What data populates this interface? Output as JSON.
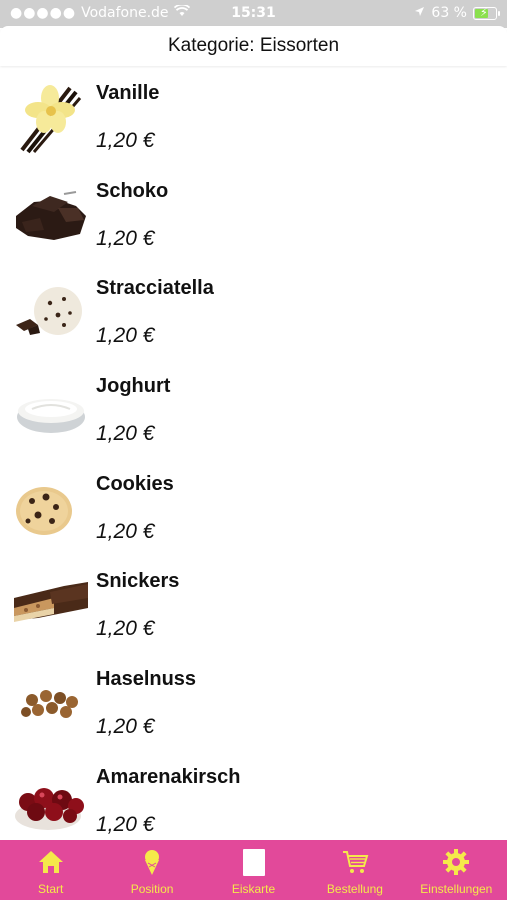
{
  "status_bar": {
    "carrier": "Vodafone.de",
    "time": "15:31",
    "battery": "63 %"
  },
  "header": {
    "title": "Kategorie: Eissorten"
  },
  "items": [
    {
      "name": "Vanille",
      "price": "1,20 €",
      "image": "vanilla-flower-icon"
    },
    {
      "name": "Schoko",
      "price": "1,20 €",
      "image": "chocolate-icon"
    },
    {
      "name": "Stracciatella",
      "price": "1,20 €",
      "image": "stracciatella-scoop-icon"
    },
    {
      "name": "Joghurt",
      "price": "1,20 €",
      "image": "yogurt-bowl-icon"
    },
    {
      "name": "Cookies",
      "price": "1,20 €",
      "image": "cookie-icon"
    },
    {
      "name": "Snickers",
      "price": "1,20 €",
      "image": "snickers-bar-icon"
    },
    {
      "name": "Haselnuss",
      "price": "1,20 €",
      "image": "hazelnut-icon"
    },
    {
      "name": "Amarenakirsch",
      "price": "1,20 €",
      "image": "cherry-bowl-icon"
    }
  ],
  "tabbar": {
    "accent_color": "#f5e94a",
    "background_color": "#e2499a",
    "tabs": [
      {
        "label": "Start",
        "icon": "home-icon"
      },
      {
        "label": "Position",
        "icon": "ice-cream-cone-icon"
      },
      {
        "label": "Eiskarte",
        "icon": "menu-card-icon"
      },
      {
        "label": "Bestellung",
        "icon": "cart-icon"
      },
      {
        "label": "Einstellungen",
        "icon": "gear-icon"
      }
    ]
  }
}
